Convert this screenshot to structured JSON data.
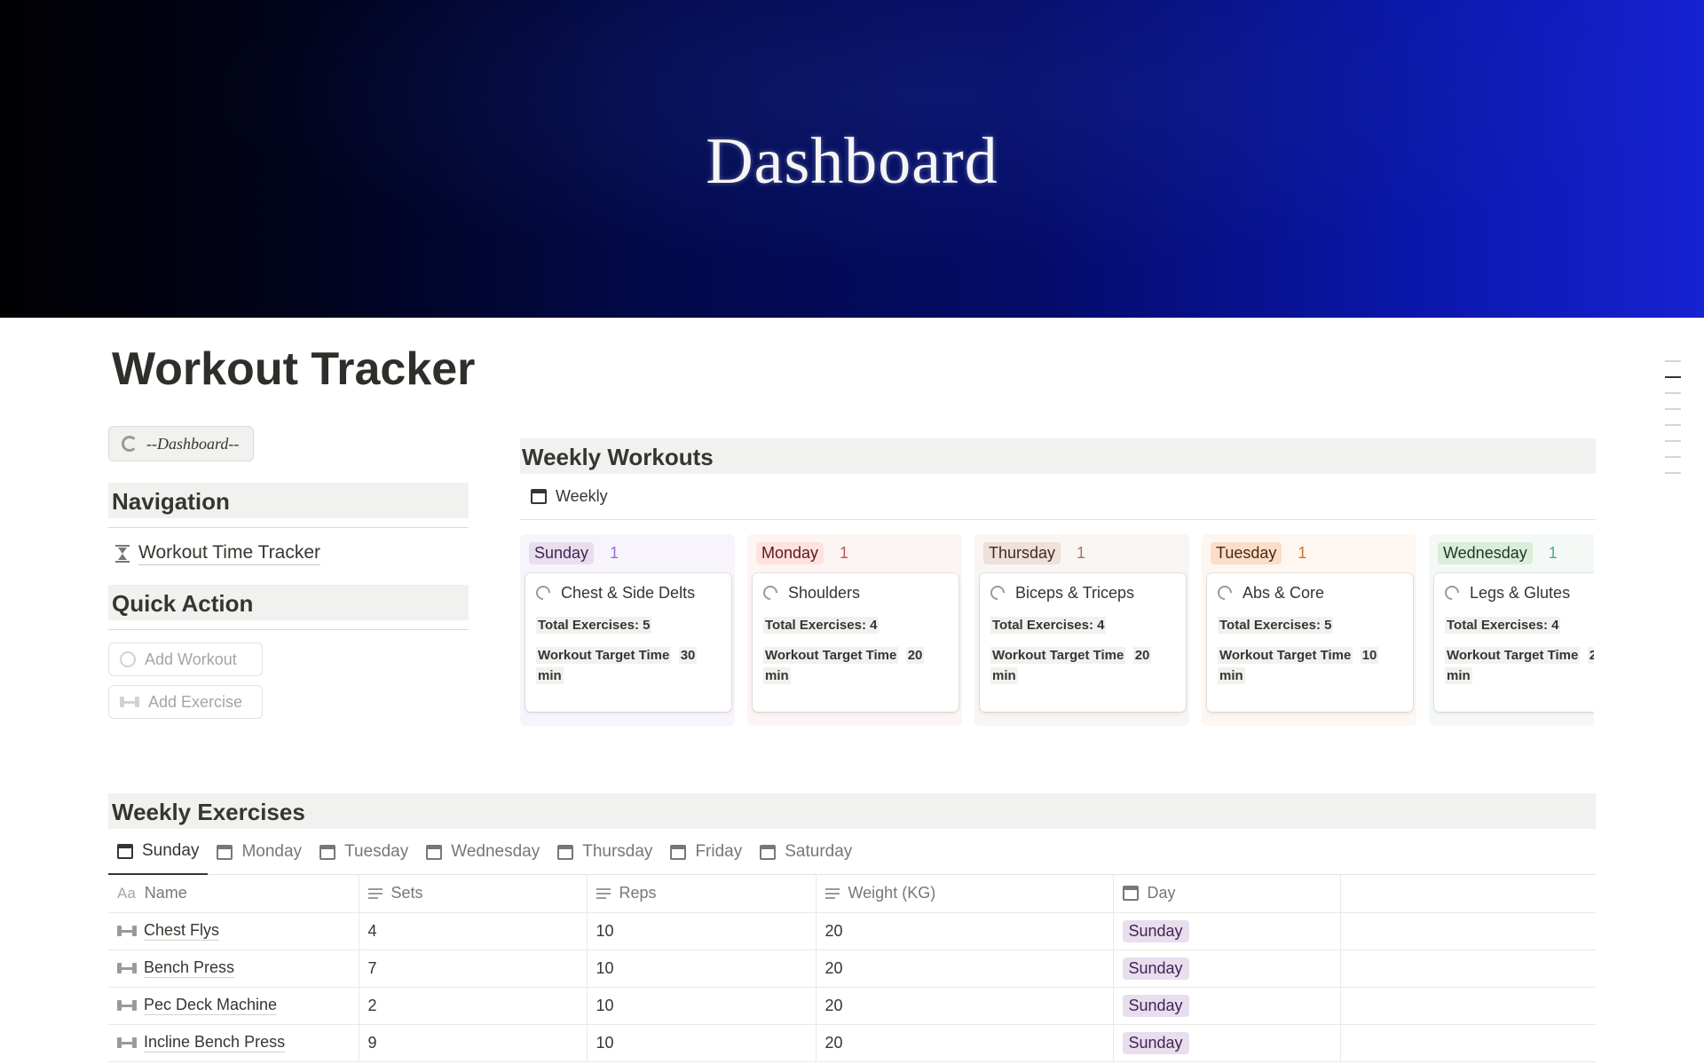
{
  "cover": {
    "title": "Dashboard"
  },
  "page": {
    "title": "Workout Tracker"
  },
  "sidebar": {
    "dashboard_button": "--Dashboard--",
    "navigation_title": "Navigation",
    "navigation_link": "Workout Time Tracker",
    "quick_action_title": "Quick Action",
    "add_workout": "Add Workout",
    "add_exercise": "Add Exercise"
  },
  "weekly_workouts": {
    "title": "Weekly Workouts",
    "view_label": "Weekly",
    "columns": [
      {
        "day": "Sunday",
        "count": "1",
        "bg": "#f8f4fb",
        "tag_bg": "#e8deee",
        "tag_fg": "#412454",
        "count_fg": "#9a6dd7",
        "card": {
          "title": "Chest & Side Delts",
          "total": "Total Exercises: 5",
          "target_label": "Workout Target Time",
          "target_value": "30",
          "unit": "min"
        }
      },
      {
        "day": "Monday",
        "count": "1",
        "bg": "#fdf5f4",
        "tag_bg": "#ffe2dd",
        "tag_fg": "#5d1715",
        "count_fg": "#c4554d",
        "card": {
          "title": "Shoulders",
          "total": "Total Exercises: 4",
          "target_label": "Workout Target Time",
          "target_value": "20",
          "unit": "min"
        }
      },
      {
        "day": "Thursday",
        "count": "1",
        "bg": "#f9f5f3",
        "tag_bg": "#eee0da",
        "tag_fg": "#442a1e",
        "count_fg": "#a27763",
        "card": {
          "title": "Biceps & Triceps",
          "total": "Total Exercises: 4",
          "target_label": "Workout Target Time",
          "target_value": "20",
          "unit": "min"
        }
      },
      {
        "day": "Tuesday",
        "count": "1",
        "bg": "#fdf6f1",
        "tag_bg": "#fadec9",
        "tag_fg": "#49290e",
        "count_fg": "#cc782f",
        "card": {
          "title": "Abs & Core",
          "total": "Total Exercises: 5",
          "target_label": "Workout Target Time",
          "target_value": "10",
          "unit": "min"
        }
      },
      {
        "day": "Wednesday",
        "count": "1",
        "bg": "#f5f9f6",
        "tag_bg": "#dbeddb",
        "tag_fg": "#1c3829",
        "count_fg": "#4dab9a",
        "card": {
          "title": "Legs & Glutes",
          "total": "Total Exercises: 4",
          "target_label": "Workout Target Time",
          "target_value": "2",
          "unit": "min"
        }
      }
    ]
  },
  "weekly_exercises": {
    "title": "Weekly Exercises",
    "tabs": [
      "Sunday",
      "Monday",
      "Tuesday",
      "Wednesday",
      "Thursday",
      "Friday",
      "Saturday"
    ],
    "active_tab": "Sunday",
    "headers": {
      "name_prefix": "Aa",
      "name": "Name",
      "sets": "Sets",
      "reps": "Reps",
      "weight": "Weight (KG)",
      "day": "Day"
    },
    "rows": [
      {
        "name": "Chest Flys",
        "sets": "4",
        "reps": "10",
        "weight": "20",
        "day": "Sunday"
      },
      {
        "name": "Bench Press",
        "sets": "7",
        "reps": "10",
        "weight": "20",
        "day": "Sunday"
      },
      {
        "name": "Pec Deck Machine",
        "sets": "2",
        "reps": "10",
        "weight": "20",
        "day": "Sunday"
      },
      {
        "name": "Incline Bench Press",
        "sets": "9",
        "reps": "10",
        "weight": "20",
        "day": "Sunday"
      }
    ]
  }
}
